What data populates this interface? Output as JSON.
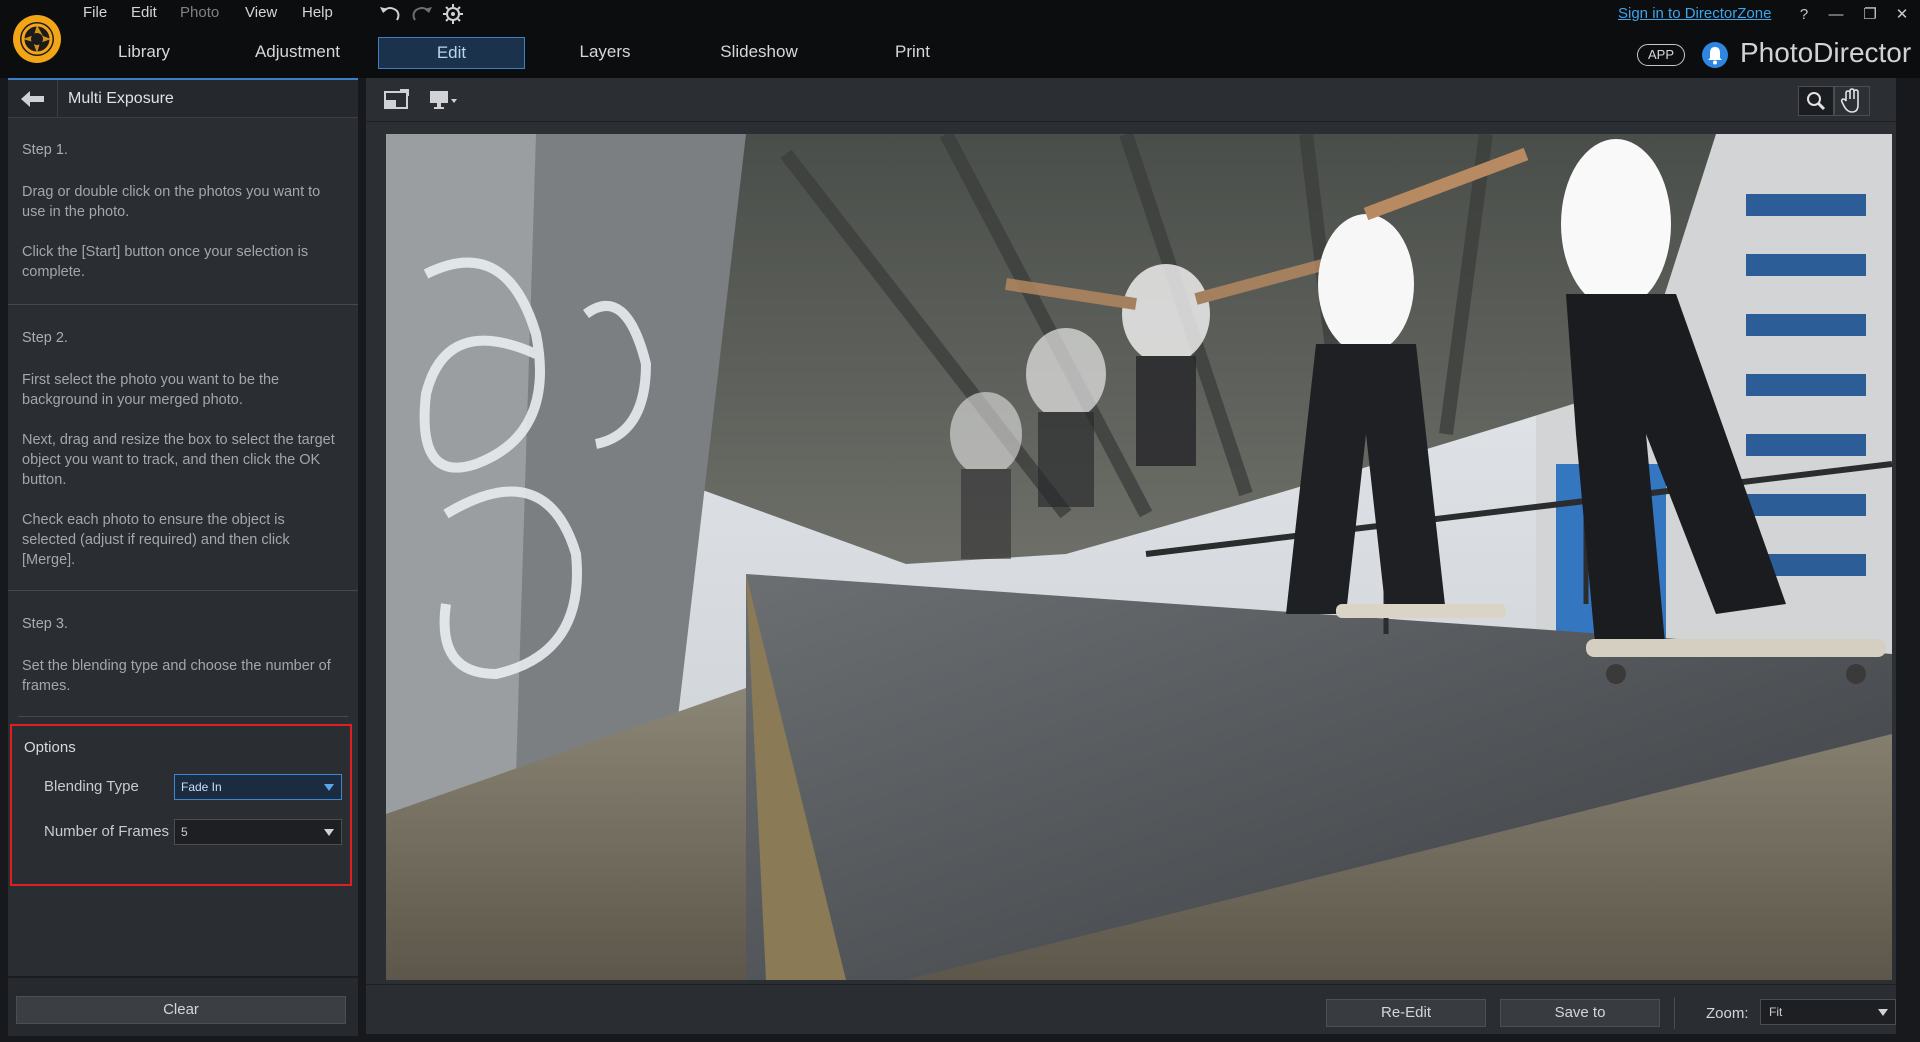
{
  "menu": {
    "file": "File",
    "edit": "Edit",
    "photo": "Photo",
    "view": "View",
    "help": "Help"
  },
  "tabs": [
    {
      "label": "Library"
    },
    {
      "label": "Adjustment"
    },
    {
      "label": "Edit"
    },
    {
      "label": "Layers"
    },
    {
      "label": "Slideshow"
    },
    {
      "label": "Print"
    }
  ],
  "header": {
    "signin": "Sign in to DirectorZone",
    "help_glyph": "?",
    "minimize_glyph": "—",
    "restore_glyph": "❐",
    "close_glyph": "✕",
    "app_badge": "APP",
    "brand": "PhotoDirector"
  },
  "panel": {
    "title": "Multi Exposure",
    "step1_title": "Step 1.",
    "step1_p1": "Drag or double click on the photos you want to use in the photo.",
    "step1_p2": "Click the [Start] button once your selection is complete.",
    "step2_title": "Step 2.",
    "step2_p1": "First select the photo you want to be the background in your merged photo.",
    "step2_p2": "Next, drag and resize the box to select the target object you want to track, and then click the OK button.",
    "step2_p3": "Check each photo to ensure the object is selected (adjust if required) and then click [Merge].",
    "step3_title": "Step 3.",
    "step3_p1": "Set the blending type and choose the number of frames.",
    "options_label": "Options",
    "blending_label": "Blending Type",
    "blending_value": "Fade In",
    "frames_label": "Number of Frames",
    "frames_value": "5",
    "clear": "Clear"
  },
  "viewer": {
    "reedit": "Re-Edit",
    "saveto": "Save to",
    "zoom_label": "Zoom:",
    "zoom_value": "Fit"
  },
  "colors": {
    "accent": "#3b7fc4",
    "highlight_box": "#e02020",
    "link": "#3fa4ea"
  }
}
